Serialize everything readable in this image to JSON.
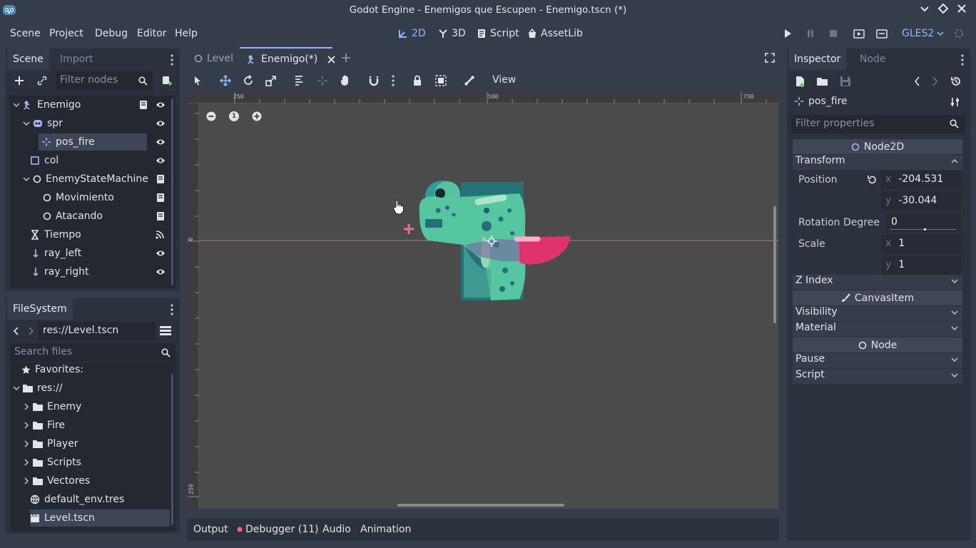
{
  "window": {
    "title": "Godot Engine - Enemigos que Escupen - Enemigo.tscn (*)"
  },
  "menu": {
    "items": [
      "Scene",
      "Project",
      "Debug",
      "Editor",
      "Help"
    ]
  },
  "workspaces": {
    "items": [
      "2D",
      "3D",
      "Script",
      "AssetLib"
    ],
    "active": "2D"
  },
  "renderer": "GLES2",
  "scene_dock": {
    "tabs": [
      "Scene",
      "Import"
    ],
    "filter_placeholder": "Filter nodes",
    "nodes": [
      "Enemigo",
      "spr",
      "pos_fire",
      "col",
      "EnemyStateMachine",
      "Movimiento",
      "Atacando",
      "Tiempo",
      "ray_left",
      "ray_right"
    ],
    "selected": "pos_fire"
  },
  "filesystem": {
    "tab": "FileSystem",
    "path": "res://Level.tscn",
    "search_placeholder": "Search files",
    "items": [
      "Favorites:",
      "res://",
      "Enemy",
      "Fire",
      "Player",
      "Scripts",
      "Vectores",
      "default_env.tres",
      "Level.tscn"
    ],
    "selected": "Level.tscn"
  },
  "editor_tabs": {
    "items": [
      "Level",
      "Enemigo(*)"
    ],
    "active": "Enemigo(*)"
  },
  "viewport": {
    "view_menu": "View",
    "ruler_top": [
      "250",
      "500",
      "750"
    ],
    "ruler_left": [
      "0",
      "250"
    ],
    "zoom_reset": "1"
  },
  "bottom_panel": {
    "tabs": [
      "Output",
      "Debugger (11)",
      "Audio",
      "Animation"
    ]
  },
  "inspector": {
    "tabs": [
      "Inspector",
      "Node"
    ],
    "node_name": "pos_fire",
    "filter_placeholder": "Filter properties",
    "class_node2d": "Node2D",
    "transform_label": "Transform",
    "position_label": "Position",
    "position_x": "-204.531",
    "position_y": "-30.044",
    "axis_x": "x",
    "axis_y": "y",
    "rotation_label": "Rotation Degree",
    "rotation_value": "0",
    "scale_label": "Scale",
    "scale_x": "1",
    "scale_y": "1",
    "z_index_label": "Z Index",
    "class_canvasitem": "CanvasItem",
    "visibility_label": "Visibility",
    "material_label": "Material",
    "class_node": "Node",
    "pause_label": "Pause",
    "script_label": "Script"
  },
  "colors": {
    "accent": "#8fb8ff",
    "background": "#363d4a",
    "panel": "#2c323d",
    "viewport": "#4b4b4b"
  }
}
